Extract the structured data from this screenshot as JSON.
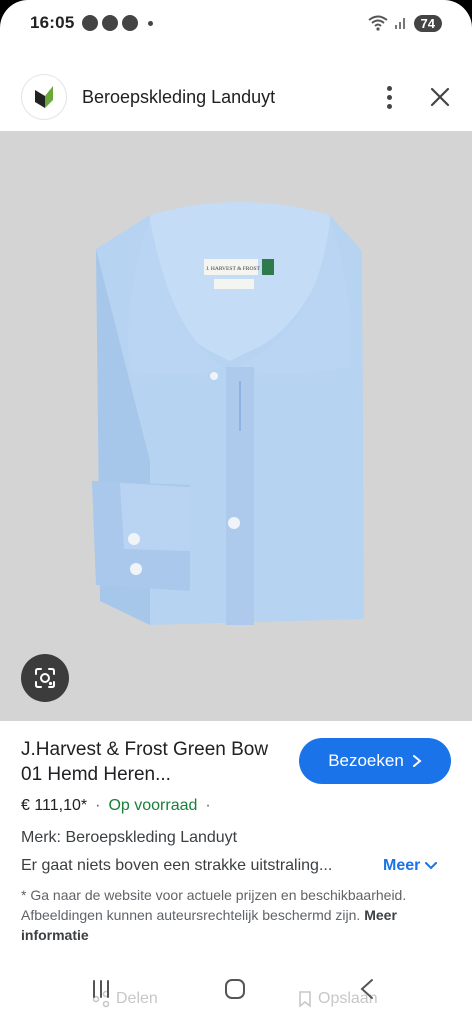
{
  "status_bar": {
    "time": "16:05",
    "battery": "74"
  },
  "header": {
    "site_name": "Beroepskleding Landuyt",
    "icons": [
      "site-logo",
      "more-vert-icon",
      "close-icon"
    ]
  },
  "image": {
    "description_icon": "lens-icon",
    "label_brand": "J. HARVEST & FROST"
  },
  "product": {
    "title": "J.Harvest & Frost Green Bow 01 Hemd Heren...",
    "visit_label": "Bezoeken",
    "price": "€ 111,10*",
    "stock": "Op voorraad",
    "brand_line": "Merk: Beroepskleding Landuyt",
    "description": "Er gaat niets boven een strakke uitstraling...",
    "more_label": "Meer",
    "disclaimer": "* Ga naar de website voor actuele prijzen en beschikbaarheid. Afbeeldingen kunnen auteursrechtelijk beschermd zijn.",
    "more_info_label": "Meer informatie"
  },
  "bottom_actions": {
    "share_label": "Delen",
    "save_label": "Opslaan"
  },
  "colors": {
    "accent": "#1a73e8",
    "stock_green": "#188038",
    "image_bg": "#d4d4d4",
    "shirt": "#b6d3f2"
  }
}
